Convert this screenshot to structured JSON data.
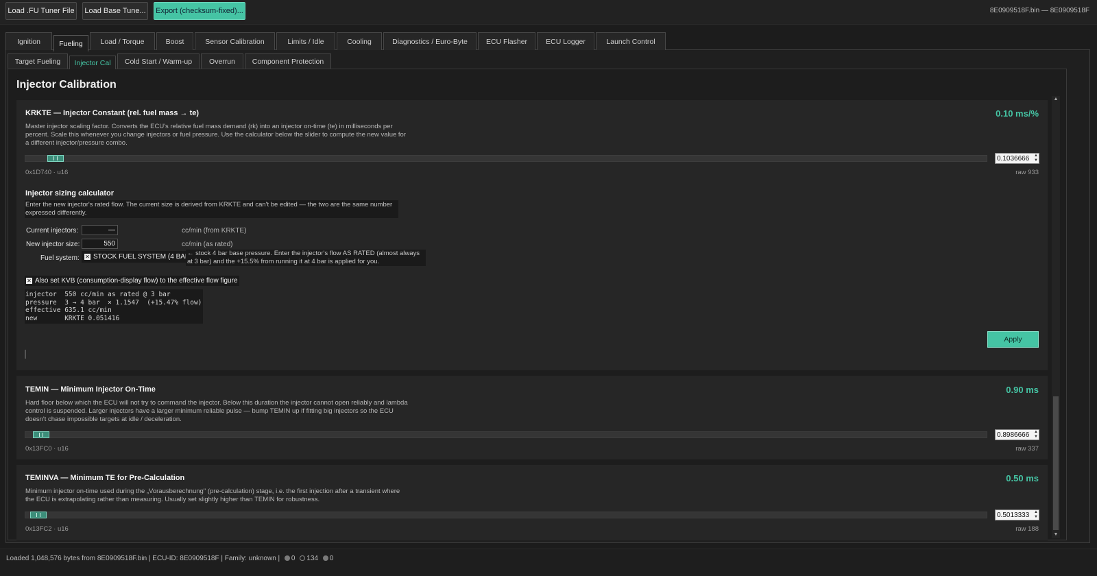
{
  "toolbar": {
    "load_fu": "Load .FU Tuner File",
    "load_base": "Load Base Tune...",
    "export": "Export (checksum-fixed)...",
    "file_id": "8E0909518F.bin — 8E0909518F"
  },
  "main_tabs": [
    "Ignition",
    "Fueling",
    "Load / Torque",
    "Boost",
    "Sensor Calibration",
    "Limits / Idle",
    "Cooling",
    "Diagnostics / Euro-Byte",
    "ECU Flasher",
    "ECU Logger",
    "Launch Control"
  ],
  "main_tab_active": "Fueling",
  "sub_tabs": [
    "Target Fueling",
    "Injector Cal",
    "Cold Start / Warm-up",
    "Overrun",
    "Component Protection"
  ],
  "sub_tab_active": "Injector Cal",
  "page_title": "Injector Calibration",
  "krkte": {
    "title": "KRKTE — Injector Constant (rel. fuel mass → te)",
    "value": "0.10 ms/%",
    "desc": "Master injector scaling factor. Converts the ECU's relative fuel mass demand (rk) into an injector on-time (te) in milliseconds per percent. Scale this whenever you change injectors or fuel pressure. Use the calculator below the slider to compute the new value for a different injector/pressure combo.",
    "spin": "0.1036666",
    "slider_fraction": 0.02,
    "addr": "0x1D740 · u16",
    "raw": "raw 933"
  },
  "calculator": {
    "title": "Injector sizing calculator",
    "desc": "Enter the new injector's rated flow. The current size is derived from KRKTE and can't be edited — the two are the same number expressed differently.",
    "current_label": "Current injectors:",
    "current_value": "—",
    "current_unit": "cc/min  (from KRKTE)",
    "new_label": "New injector size:",
    "new_value": "550",
    "new_unit": "cc/min  (as rated)",
    "fuel_label": "Fuel system:",
    "fuel_value": "STOCK FUEL SYSTEM (4 BAR)",
    "fuel_note": "← stock 4 bar base pressure. Enter the injector's flow AS RATED (almost always at 3 bar) and the +15.5% from running it at 4 bar is applied for you.",
    "kvb_label": "Also set KVB (consumption-display flow) to the effective flow figure",
    "output": "injector  550 cc/min as rated @ 3 bar\npressure  3 → 4 bar  × 1.1547  (+15.47% flow)\neffective 635.1 cc/min\nnew       KRKTE 0.051416",
    "apply": "Apply"
  },
  "temin": {
    "title": "TEMIN — Minimum Injector On-Time",
    "value": "0.90 ms",
    "desc": "Hard floor below which the ECU will not try to command the injector. Below this duration the injector cannot open reliably and lambda control is suspended. Larger injectors have a larger minimum reliable pulse — bump TEMIN up if fitting big injectors so the ECU doesn't chase impossible targets at idle / deceleration.",
    "spin": "0.8986666",
    "slider_fraction": 0.005,
    "addr": "0x13FC0 · u16",
    "raw": "raw 337"
  },
  "teminva": {
    "title": "TEMINVA — Minimum TE for Pre-Calculation",
    "value": "0.50 ms",
    "desc": "Minimum injector on-time used during the „Vorausberechnung\" (pre-calculation) stage, i.e. the first injection after a transient where the ECU is extrapolating rather than measuring. Usually set slightly higher than TEMIN for robustness.",
    "spin": "0.5013333",
    "slider_fraction": 0.002,
    "addr": "0x13FC2 · u16",
    "raw": "raw 188"
  },
  "status": {
    "text": "Loaded 1,048,576 bytes from 8E0909518F.bin   |   ECU-ID: 8E0909518F   |   Family: unknown   |",
    "c1": "0",
    "c2": "134",
    "c3": "0"
  },
  "colors": {
    "accent": "#45c4a4",
    "background": "#1c1c1c",
    "card": "#262626"
  }
}
